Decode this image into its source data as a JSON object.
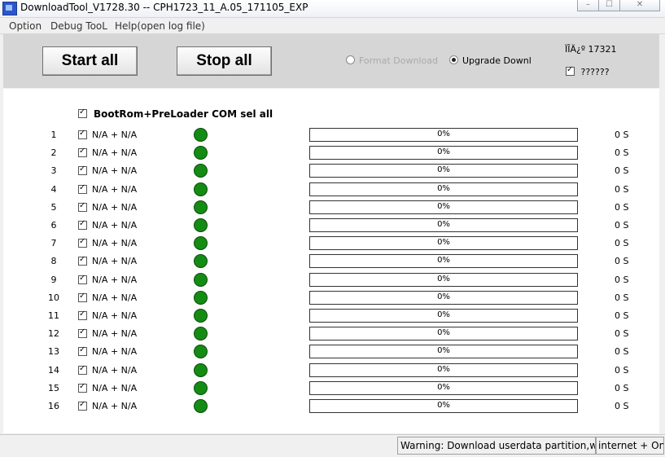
{
  "window": {
    "title": "DownloadTool_V1728.30 -- CPH1723_11_A.05_171105_EXP",
    "controls": {
      "minimize": "–",
      "maximize": "☐",
      "close": "✕"
    }
  },
  "menu": [
    "Option",
    "Debug TooL",
    "Help(open log file)"
  ],
  "toolbar": {
    "start_label": "Start all",
    "stop_label": "Stop all",
    "format_label": "Format Download",
    "upgrade_label": "Upgrade Downloa",
    "selected_mode": "upgrade",
    "counter_text": "ÏÎÄ¿º 17321",
    "check_label": "??????"
  },
  "header": {
    "label": "BootRom+PreLoader COM sel all",
    "checked": true
  },
  "rows": [
    {
      "num": "1",
      "label": "N/A + N/A",
      "progress": "0%",
      "time": "0 S"
    },
    {
      "num": "2",
      "label": "N/A + N/A",
      "progress": "0%",
      "time": "0 S"
    },
    {
      "num": "3",
      "label": "N/A + N/A",
      "progress": "0%",
      "time": "0 S"
    },
    {
      "num": "4",
      "label": "N/A + N/A",
      "progress": "0%",
      "time": "0 S"
    },
    {
      "num": "5",
      "label": "N/A + N/A",
      "progress": "0%",
      "time": "0 S"
    },
    {
      "num": "6",
      "label": "N/A + N/A",
      "progress": "0%",
      "time": "0 S"
    },
    {
      "num": "7",
      "label": "N/A + N/A",
      "progress": "0%",
      "time": "0 S"
    },
    {
      "num": "8",
      "label": "N/A + N/A",
      "progress": "0%",
      "time": "0 S"
    },
    {
      "num": "9",
      "label": "N/A + N/A",
      "progress": "0%",
      "time": "0 S"
    },
    {
      "num": "10",
      "label": "N/A + N/A",
      "progress": "0%",
      "time": "0 S"
    },
    {
      "num": "11",
      "label": "N/A + N/A",
      "progress": "0%",
      "time": "0 S"
    },
    {
      "num": "12",
      "label": "N/A + N/A",
      "progress": "0%",
      "time": "0 S"
    },
    {
      "num": "13",
      "label": "N/A + N/A",
      "progress": "0%",
      "time": "0 S"
    },
    {
      "num": "14",
      "label": "N/A + N/A",
      "progress": "0%",
      "time": "0 S"
    },
    {
      "num": "15",
      "label": "N/A + N/A",
      "progress": "0%",
      "time": "0 S"
    },
    {
      "num": "16",
      "label": "N/A + N/A",
      "progress": "0%",
      "time": "0 S"
    }
  ],
  "status": {
    "warning": "Warning: Download userdata partition,will lo",
    "mode": "internet + Onl"
  },
  "colors": {
    "led_green": "#148c14",
    "toolbar_bg": "#d6d6d6"
  }
}
